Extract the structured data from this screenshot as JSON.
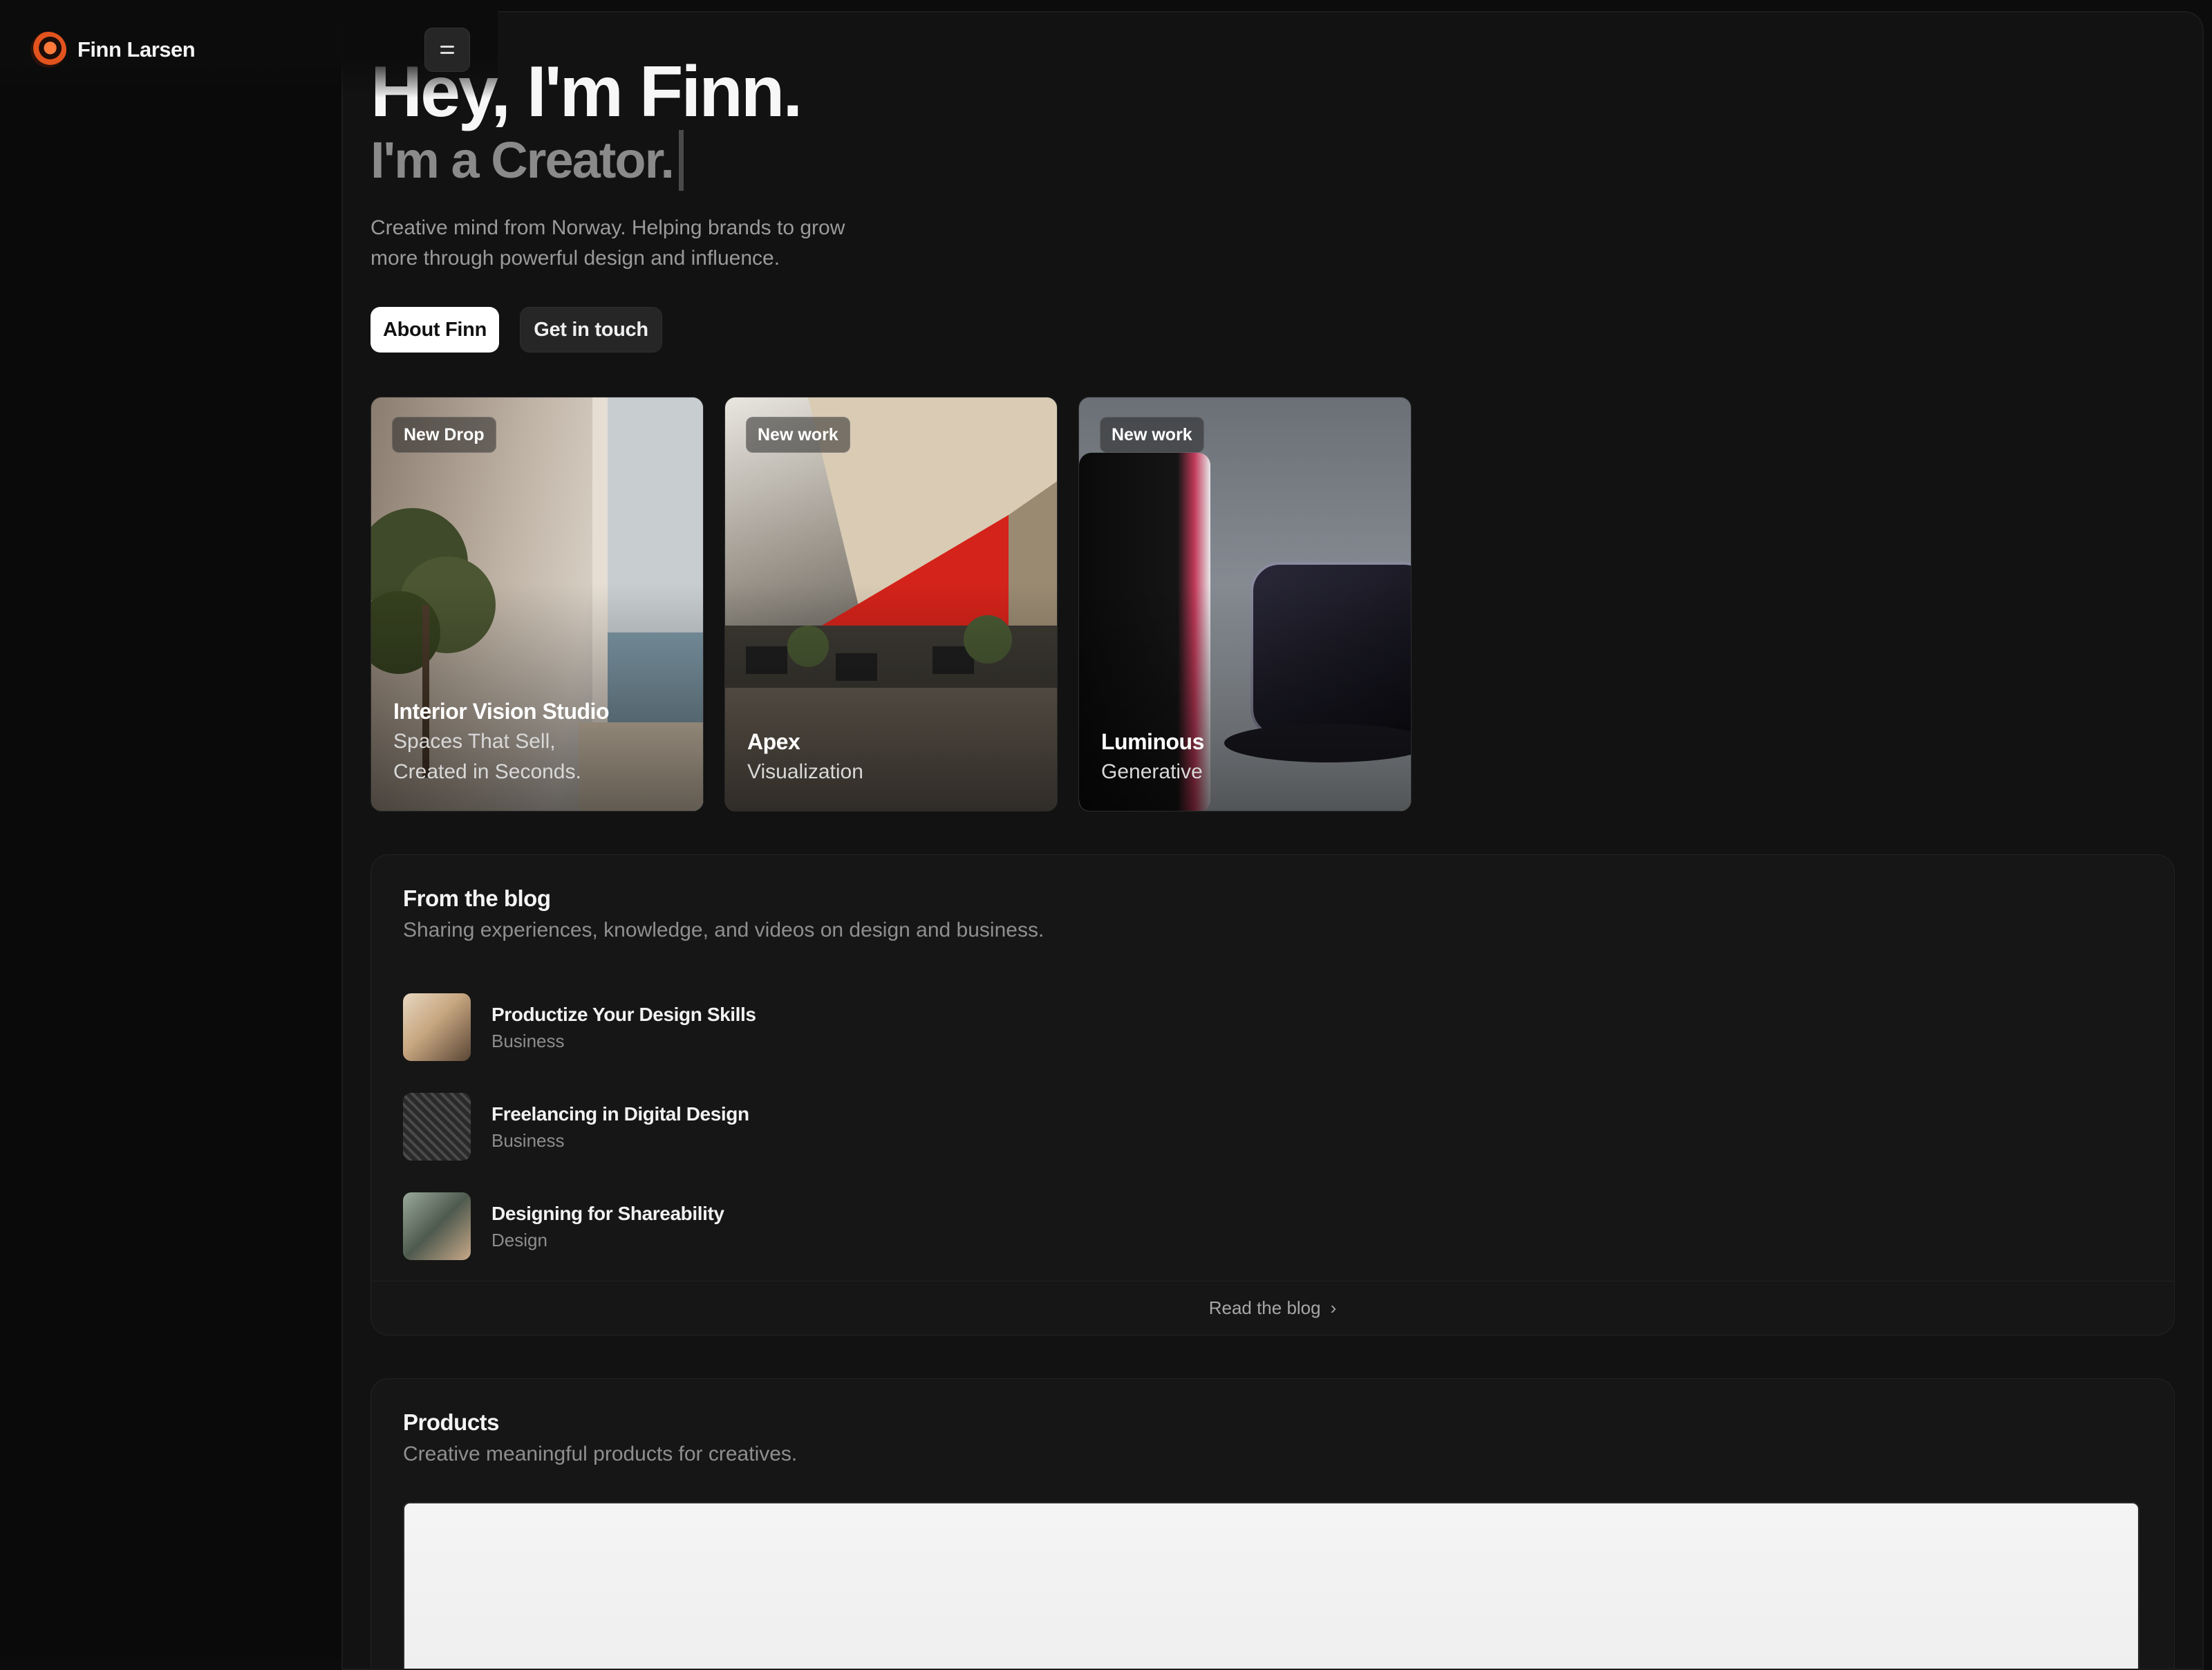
{
  "brand": {
    "name": "Finn Larsen"
  },
  "hero": {
    "title": "Hey, I'm Finn.",
    "subtitle": "I'm a Creator.",
    "description": "Creative mind from Norway. Helping brands to grow more through powerful design and influence.",
    "primary_button": "About Finn",
    "secondary_button": "Get in touch"
  },
  "cards": [
    {
      "badge": "New Drop",
      "title": "Interior Vision Studio",
      "subtitle": "Spaces That Sell,\nCreated in Seconds."
    },
    {
      "badge": "New work",
      "title": "Apex",
      "subtitle": "Visualization"
    },
    {
      "badge": "New work",
      "title": "Luminous",
      "subtitle": "Generative"
    }
  ],
  "blog": {
    "title": "From the blog",
    "subtitle": "Sharing experiences, knowledge, and videos on design and business.",
    "posts": [
      {
        "title": "Productize Your Design Skills",
        "category": "Business"
      },
      {
        "title": "Freelancing in Digital Design",
        "category": "Business"
      },
      {
        "title": "Designing for Shareability",
        "category": "Design"
      }
    ],
    "footer_link": "Read the blog"
  },
  "products": {
    "title": "Products",
    "subtitle": "Creative meaningful products for creatives."
  },
  "icons": {
    "menu": "menu-icon",
    "chevron": "chevron-right-icon"
  },
  "colors": {
    "background": "#0c0c0c",
    "panel": "#121212",
    "accent": "#e2531d"
  }
}
